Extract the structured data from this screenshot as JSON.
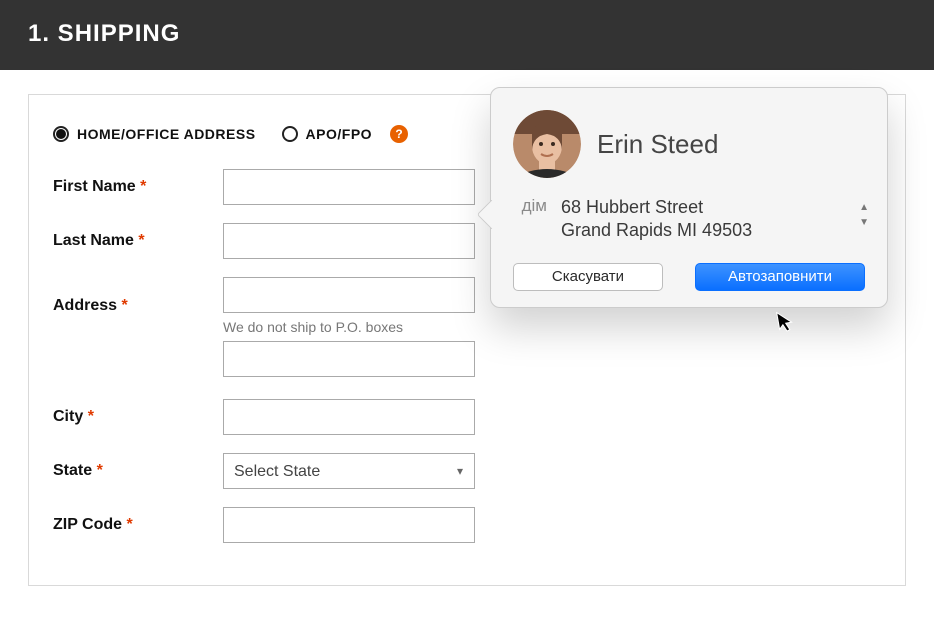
{
  "header": {
    "title": "1. SHIPPING"
  },
  "address_type": {
    "home_label": "HOME/OFFICE ADDRESS",
    "apo_label": "APO/FPO",
    "help_glyph": "?"
  },
  "form": {
    "first_name": {
      "label": "First Name",
      "required": "*",
      "value": ""
    },
    "last_name": {
      "label": "Last Name",
      "required": "*",
      "value": ""
    },
    "address": {
      "label": "Address",
      "required": "*",
      "value": "",
      "hint": "We do not ship to P.O. boxes"
    },
    "address2": {
      "value": ""
    },
    "city": {
      "label": "City",
      "required": "*",
      "value": ""
    },
    "state": {
      "label": "State",
      "required": "*",
      "selected": "Select State"
    },
    "zip": {
      "label": "ZIP Code",
      "required": "*",
      "value": ""
    }
  },
  "popover": {
    "contact_name": "Erin Steed",
    "address_label": "дім",
    "address_line1": "68 Hubbert Street",
    "address_line2": "Grand Rapids MI 49503",
    "cancel_label": "Скасувати",
    "autofill_label": "Автозаповнити"
  }
}
